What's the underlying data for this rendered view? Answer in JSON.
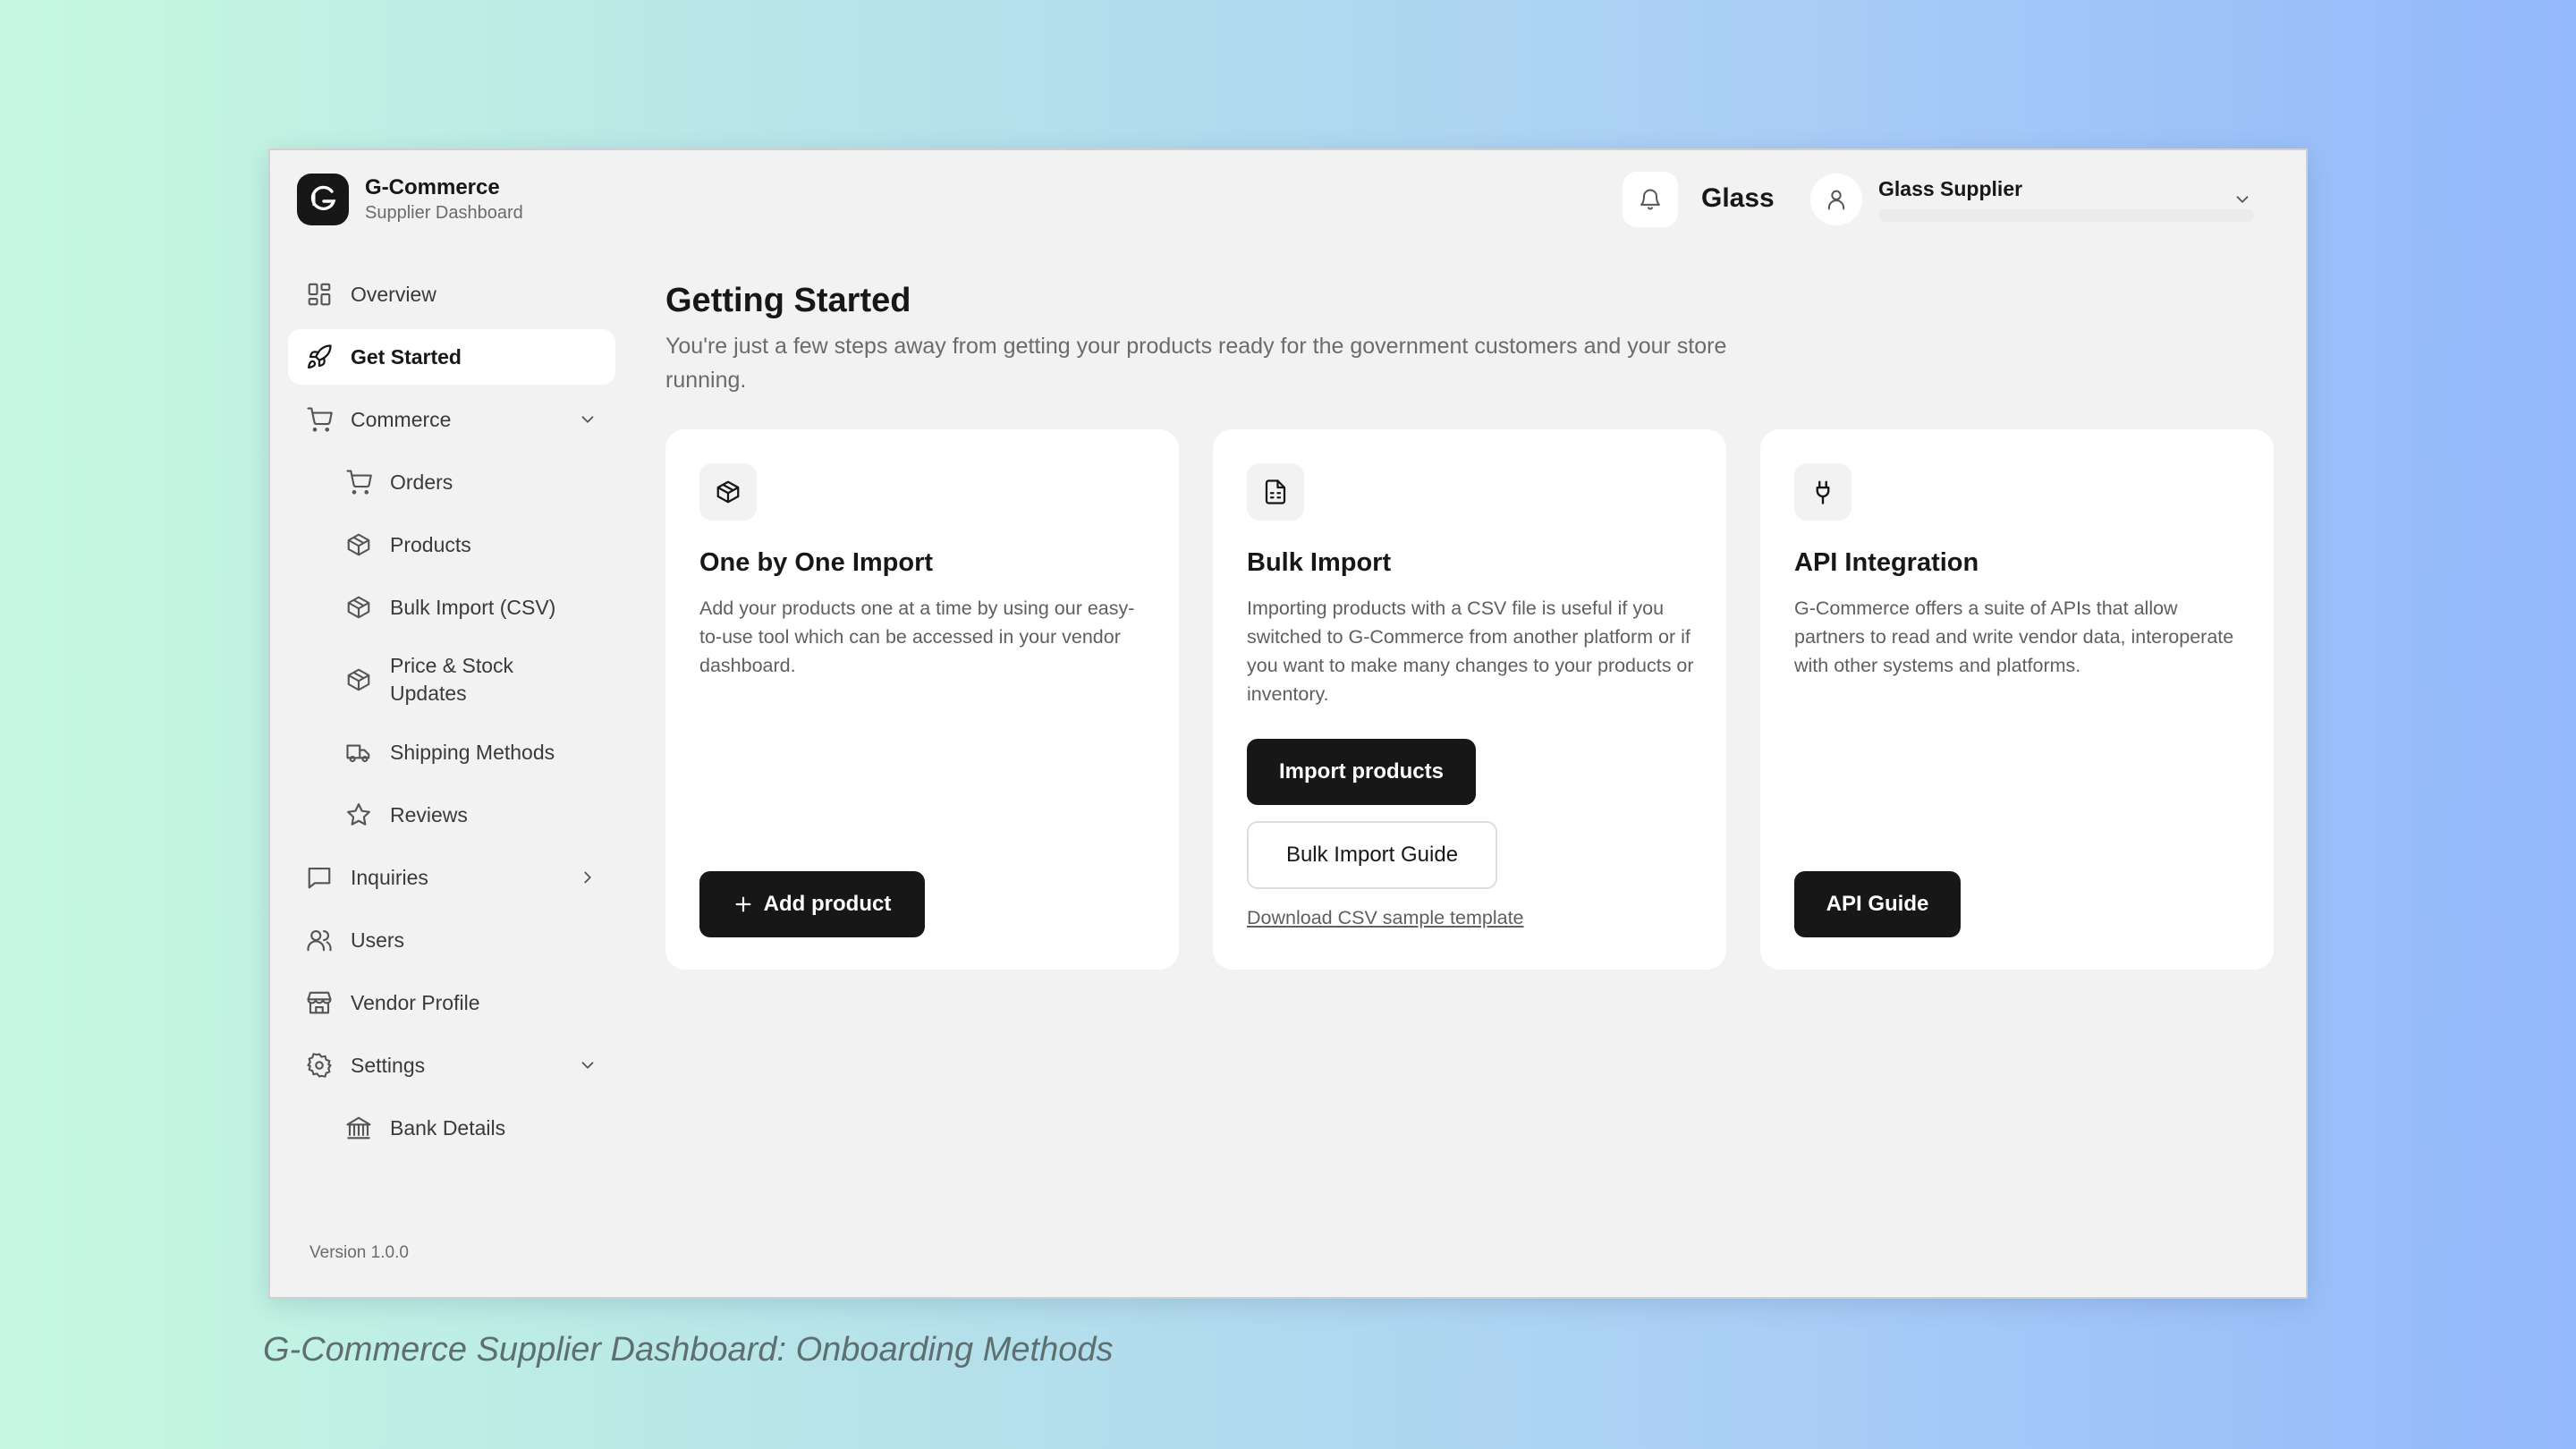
{
  "brand": {
    "name": "G-Commerce",
    "subtitle": "Supplier Dashboard"
  },
  "header": {
    "tenant": "Glass",
    "account_name": "Glass Supplier"
  },
  "sidebar": {
    "items": [
      {
        "label": "Overview",
        "icon": "grid-icon"
      },
      {
        "label": "Get Started",
        "icon": "rocket-icon",
        "active": true
      },
      {
        "label": "Commerce",
        "icon": "cart-icon",
        "expanded": true
      },
      {
        "label": "Orders",
        "icon": "cart-icon"
      },
      {
        "label": "Products",
        "icon": "box-icon"
      },
      {
        "label": "Bulk Import (CSV)",
        "icon": "box-icon"
      },
      {
        "label": "Price & Stock Updates",
        "icon": "box-icon"
      },
      {
        "label": "Shipping Methods",
        "icon": "truck-icon"
      },
      {
        "label": "Reviews",
        "icon": "star-icon"
      },
      {
        "label": "Inquiries",
        "icon": "message-icon",
        "expanded": false
      },
      {
        "label": "Users",
        "icon": "users-icon"
      },
      {
        "label": "Vendor Profile",
        "icon": "store-icon"
      },
      {
        "label": "Settings",
        "icon": "gear-icon",
        "expanded": true
      },
      {
        "label": "Bank Details",
        "icon": "bank-icon"
      }
    ],
    "version": "Version 1.0.0"
  },
  "main": {
    "title": "Getting Started",
    "description": "You're just a few steps away from getting your products ready for the government customers and your store running.",
    "cards": [
      {
        "icon": "box-icon",
        "title": "One by One Import",
        "description": "Add your products one at a time by using our easy-to-use tool which can be accessed in your vendor dashboard.",
        "primary_button": "Add product"
      },
      {
        "icon": "file-icon",
        "title": "Bulk Import",
        "description": "Importing products with a CSV file is useful if you switched to G-Commerce from another platform or if you want to make many changes to your products or inventory.",
        "primary_button": "Import products",
        "secondary_button": "Bulk Import Guide",
        "link": "Download CSV sample template"
      },
      {
        "icon": "plug-icon",
        "title": "API Integration",
        "description": "G-Commerce offers a suite of APIs that allow partners to read and write vendor data, interoperate with other systems and platforms.",
        "primary_button": "API Guide"
      }
    ]
  },
  "caption": "G-Commerce Supplier Dashboard: Onboarding Methods"
}
